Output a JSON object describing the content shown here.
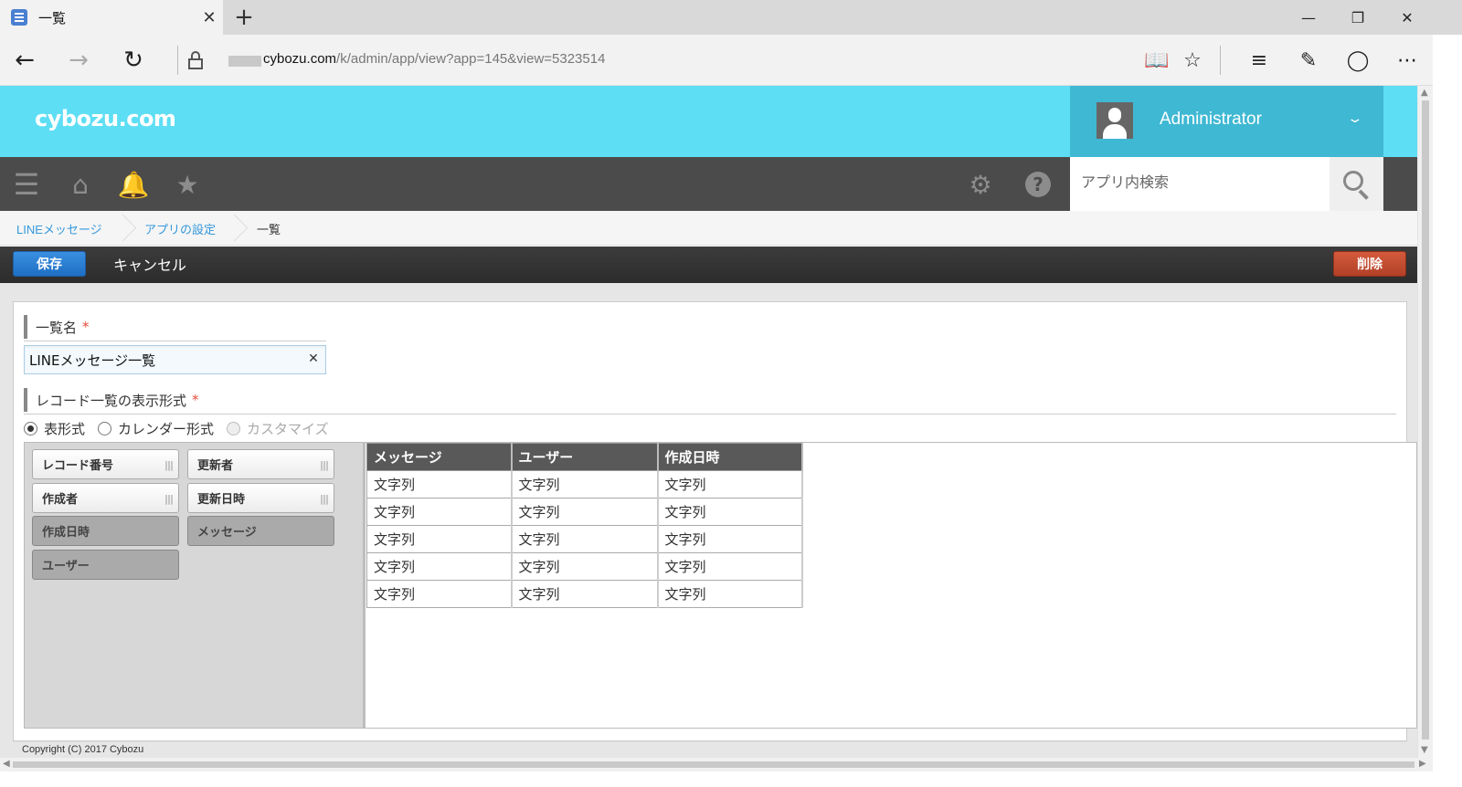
{
  "browser": {
    "tab_title": "一覧",
    "tab_close": "✕",
    "new_tab": "+",
    "url_domain": "cybozu.com",
    "url_path": "/k/admin/app/view?app=145&view=5323514",
    "icons": [
      "back-icon",
      "forward-icon",
      "refresh-icon",
      "lock-icon",
      "reading-view-icon",
      "favorite-star-icon",
      "hub-icon",
      "web-note-icon",
      "share-icon",
      "more-icon"
    ]
  },
  "header": {
    "logo": "cybozu.com",
    "user_name": "Administrator",
    "colors": {
      "header_bg": "#5ddef4",
      "user_bg": "#3fb8d3",
      "nav_bg": "#4b4b4b"
    }
  },
  "search": {
    "placeholder": "アプリ内検索"
  },
  "breadcrumb": {
    "items": [
      "LINEメッセージ",
      "アプリの設定",
      "一覧"
    ]
  },
  "actions": {
    "save": "保存",
    "cancel": "キャンセル",
    "delete": "削除",
    "colors": {
      "save": "#2a7fd4",
      "delete": "#c14d30"
    }
  },
  "form": {
    "name_label": "一覧名",
    "name_value": "LINEメッセージ一覧",
    "format_label": "レコード一覧の表示形式",
    "required_mark": "*",
    "formats": [
      {
        "label": "表形式",
        "selected": true,
        "enabled": true
      },
      {
        "label": "カレンダー形式",
        "selected": false,
        "enabled": true
      },
      {
        "label": "カスタマイズ",
        "selected": false,
        "enabled": false
      }
    ]
  },
  "palette": {
    "fields": [
      {
        "label": "レコード番号",
        "used": false
      },
      {
        "label": "更新者",
        "used": false
      },
      {
        "label": "作成者",
        "used": false
      },
      {
        "label": "更新日時",
        "used": false
      },
      {
        "label": "作成日時",
        "used": true
      },
      {
        "label": "メッセージ",
        "used": true
      },
      {
        "label": "ユーザー",
        "used": true
      }
    ]
  },
  "preview": {
    "columns": [
      "メッセージ",
      "ユーザー",
      "作成日時"
    ],
    "rows": [
      [
        "文字列",
        "文字列",
        "文字列"
      ],
      [
        "文字列",
        "文字列",
        "文字列"
      ],
      [
        "文字列",
        "文字列",
        "文字列"
      ],
      [
        "文字列",
        "文字列",
        "文字列"
      ],
      [
        "文字列",
        "文字列",
        "文字列"
      ]
    ]
  },
  "footer": {
    "copyright": "Copyright (C) 2017 Cybozu"
  }
}
